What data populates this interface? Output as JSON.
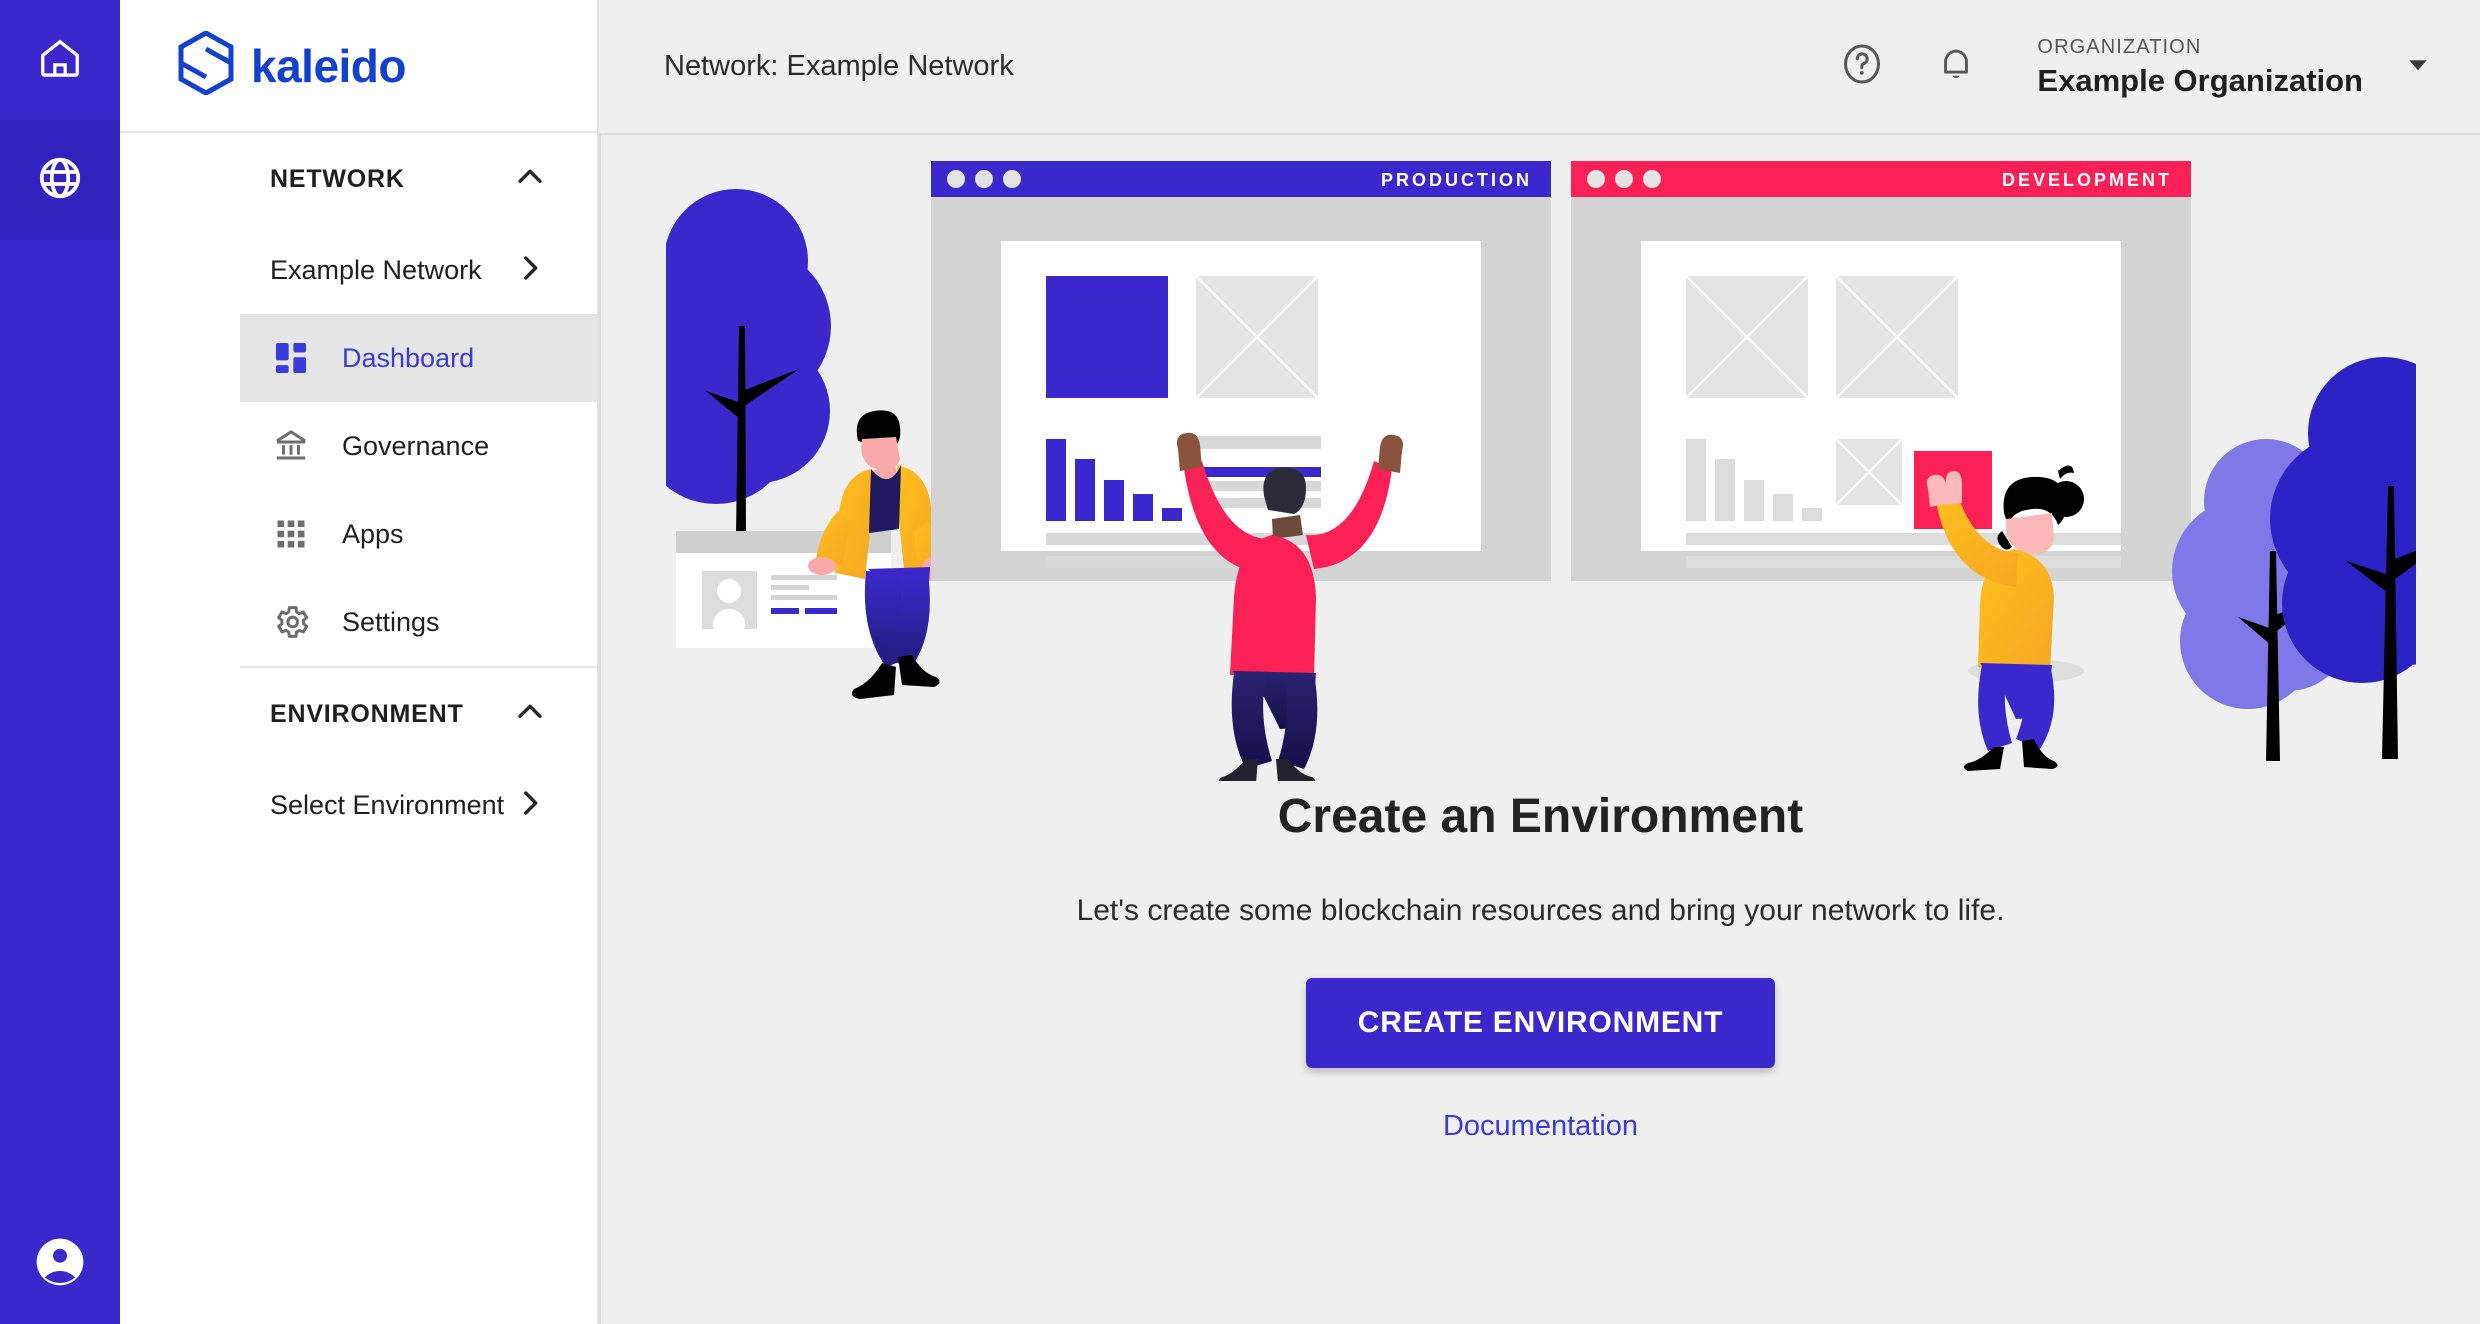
{
  "brand": {
    "name": "kaleido",
    "logo_icon": "kaleido-hex-logo",
    "color": "#1341cf"
  },
  "rail": {
    "items": [
      {
        "icon": "home-icon",
        "name": "home",
        "active": false
      },
      {
        "icon": "globe-icon",
        "name": "network",
        "active": true
      }
    ],
    "bottom": {
      "icon": "account-circle-icon",
      "name": "account"
    },
    "background": "#3B28CC",
    "active_background": "#3223BE"
  },
  "sidebar": {
    "sections": [
      {
        "title": "NETWORK",
        "collapse_icon": "chevron-up-icon",
        "items": [
          {
            "label": "Example Network",
            "icon": null,
            "trailing_icon": "chevron-right-icon",
            "active": false
          },
          {
            "label": "Dashboard",
            "icon": "dashboard-grid-icon",
            "trailing_icon": null,
            "active": true
          },
          {
            "label": "Governance",
            "icon": "bank-icon",
            "trailing_icon": null,
            "active": false
          },
          {
            "label": "Apps",
            "icon": "apps-grid-icon",
            "trailing_icon": null,
            "active": false
          },
          {
            "label": "Settings",
            "icon": "gear-icon",
            "trailing_icon": null,
            "active": false
          }
        ]
      },
      {
        "title": "ENVIRONMENT",
        "collapse_icon": "chevron-up-icon",
        "items": [
          {
            "label": "Select Environment",
            "icon": null,
            "trailing_icon": "chevron-right-icon",
            "active": false
          }
        ]
      }
    ]
  },
  "topbar": {
    "title": "Network: Example Network",
    "help_icon": "help-circle-icon",
    "notifications_icon": "bell-icon",
    "organization": {
      "label": "ORGANIZATION",
      "name": "Example Organization",
      "dropdown_icon": "triangle-down-icon"
    }
  },
  "main": {
    "heading": "Create an Environment",
    "subheading": "Let's create some blockchain resources and bring your network to life.",
    "primary_button": "CREATE ENVIRONMENT",
    "documentation_link": "Documentation",
    "illustration": {
      "name": "create-environment-illustration",
      "windows": [
        {
          "label": "PRODUCTION",
          "accent": "#3B28CC"
        },
        {
          "label": "DEVELOPMENT",
          "accent": "#FB2056"
        }
      ],
      "palette": {
        "blue": "#3B28CC",
        "blue_light": "#8078E8",
        "pink": "#FB2056",
        "yellow": "#FFC01E",
        "navy": "#1F1B5E",
        "grey": "#d3d3d3",
        "grey_light": "#e2e2e2"
      }
    }
  },
  "colors": {
    "accent": "#3B28CC",
    "link": "#3b3bdd",
    "page_bg": "#efefef",
    "sidebar_bg": "#ffffff",
    "active_nav_bg": "#e6e6e6"
  }
}
